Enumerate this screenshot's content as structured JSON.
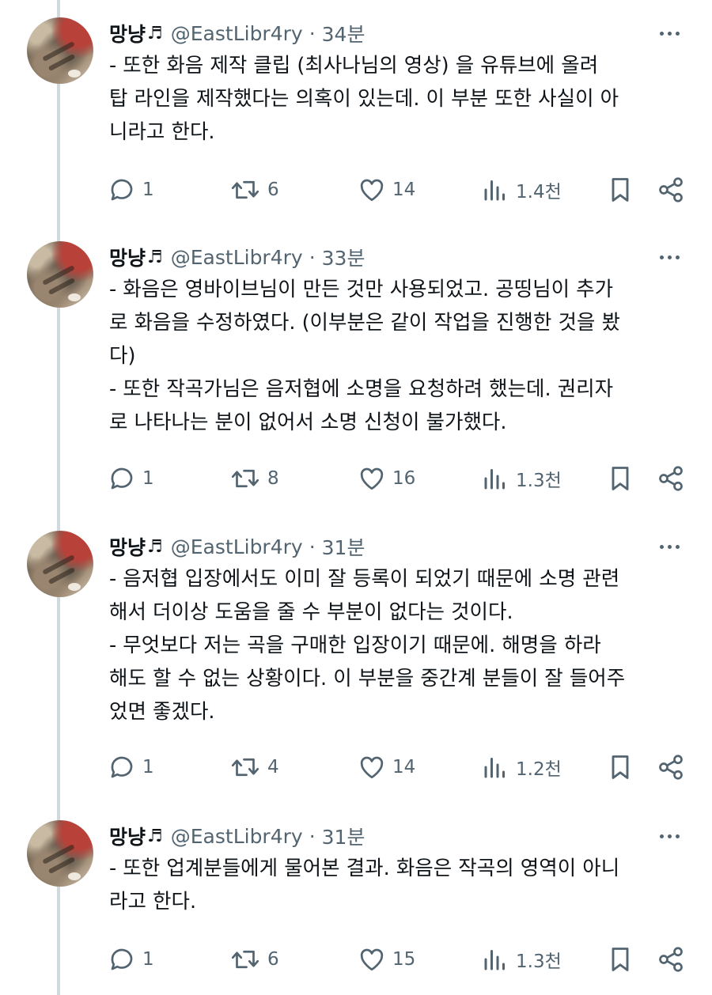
{
  "tweets": [
    {
      "name": "망냥",
      "note": "♬",
      "handle": "@EastLibr4ry",
      "separator": "·",
      "time": "34분",
      "lines": [
        "- 또한 화음 제작 클립 (최사나님의 영상) 을 유튜브에 올려",
        "탑 라인을 제작했다는 의혹이 있는데. 이 부분 또한 사실이 아",
        "니라고 한다."
      ],
      "replies": "1",
      "retweets": "6",
      "likes": "14",
      "views": "1.4천"
    },
    {
      "name": "망냥",
      "note": "♬",
      "handle": "@EastLibr4ry",
      "separator": "·",
      "time": "33분",
      "lines": [
        "- 화음은 영바이브님이 만든 것만 사용되었고. 공띵님이 추가",
        "로 화음을 수정하였다. (이부분은 같이 작업을 진행한 것을 봤",
        "다)",
        "- 또한 작곡가님은 음저협에 소명을 요청하려 했는데. 권리자",
        "로 나타나는 분이 없어서 소명 신청이 불가했다."
      ],
      "replies": "1",
      "retweets": "8",
      "likes": "16",
      "views": "1.3천"
    },
    {
      "name": "망냥",
      "note": "♬",
      "handle": "@EastLibr4ry",
      "separator": "·",
      "time": "31분",
      "lines": [
        "- 음저협 입장에서도 이미 잘 등록이 되었기 때문에 소명 관련",
        "해서 더이상 도움을 줄 수 부분이 없다는 것이다.",
        "- 무엇보다 저는 곡을 구매한 입장이기 때문에. 해명을 하라",
        "해도 할 수 없는 상황이다. 이 부분을 중간계 분들이 잘 들어주",
        "었면 좋겠다."
      ],
      "replies": "1",
      "retweets": "4",
      "likes": "14",
      "views": "1.2천"
    },
    {
      "name": "망냥",
      "note": "♬",
      "handle": "@EastLibr4ry",
      "separator": "·",
      "time": "31분",
      "lines": [
        "- 또한 업계분들에게 물어본 결과. 화음은 작곡의 영역이 아니",
        "라고 한다."
      ],
      "replies": "1",
      "retweets": "6",
      "likes": "15",
      "views": "1.3천"
    }
  ],
  "icons": {
    "reply": "reply-icon",
    "retweet": "retweet-icon",
    "like": "heart-icon",
    "views": "views-icon",
    "bookmark": "bookmark-icon",
    "share": "share-icon",
    "more": "more-icon"
  },
  "colors": {
    "text": "#0f1419",
    "secondary": "#536471",
    "thread_line": "#cfd9de",
    "background": "#ffffff"
  }
}
